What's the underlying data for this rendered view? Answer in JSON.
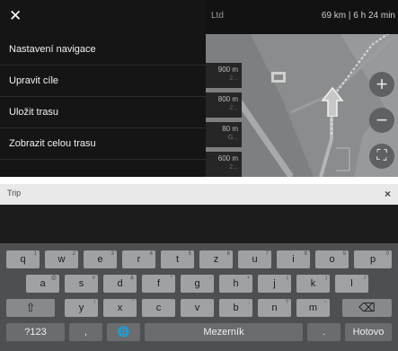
{
  "nav": {
    "close_icon": "close-icon",
    "map_header": {
      "ltd": "Ltd",
      "stats": "69 km  |  6 h 24 min"
    },
    "menu_items": [
      "Nastavení navigace",
      "Upravit cíle",
      "Uložit trasu",
      "Zobrazit celou trasu"
    ],
    "distances": [
      {
        "value": "900 m",
        "sub": "2..."
      },
      {
        "value": "800 m",
        "sub": "2..."
      },
      {
        "value": "80 m",
        "sub": "G..."
      },
      {
        "value": "600 m",
        "sub": "2..."
      }
    ],
    "map_buttons": {
      "zoom_in": "+",
      "zoom_out": "−",
      "overview": "⛶"
    }
  },
  "keyboard": {
    "search": {
      "value": "Trip",
      "close": "×"
    },
    "row1": [
      {
        "label": "q",
        "hint": "1"
      },
      {
        "label": "w",
        "hint": "2"
      },
      {
        "label": "e",
        "hint": "3"
      },
      {
        "label": "r",
        "hint": "4"
      },
      {
        "label": "t",
        "hint": "5"
      },
      {
        "label": "z",
        "hint": "6"
      },
      {
        "label": "u",
        "hint": "7"
      },
      {
        "label": "i",
        "hint": "8"
      },
      {
        "label": "o",
        "hint": "9"
      },
      {
        "label": "p",
        "hint": "0"
      }
    ],
    "row2": [
      {
        "label": "a",
        "hint": "@"
      },
      {
        "label": "s",
        "hint": "#"
      },
      {
        "label": "d",
        "hint": "&"
      },
      {
        "label": "f",
        "hint": "*"
      },
      {
        "label": "g",
        "hint": "-"
      },
      {
        "label": "h",
        "hint": "+"
      },
      {
        "label": "j",
        "hint": "("
      },
      {
        "label": "k",
        "hint": ")"
      },
      {
        "label": "l",
        "hint": "/"
      }
    ],
    "row3": [
      {
        "label": "y",
        "hint": "!"
      },
      {
        "label": "x",
        "hint": "\""
      },
      {
        "label": "c",
        "hint": "'"
      },
      {
        "label": "v",
        "hint": ":"
      },
      {
        "label": "b",
        "hint": ";"
      },
      {
        "label": "n",
        "hint": "?"
      },
      {
        "label": "m",
        "hint": "~"
      }
    ],
    "shift": "⇧",
    "backspace": "⌫",
    "numbers": "?123",
    "comma": ",",
    "globe": "🌐",
    "space": "Mezerník",
    "period": ".",
    "done": "Hotovo"
  }
}
